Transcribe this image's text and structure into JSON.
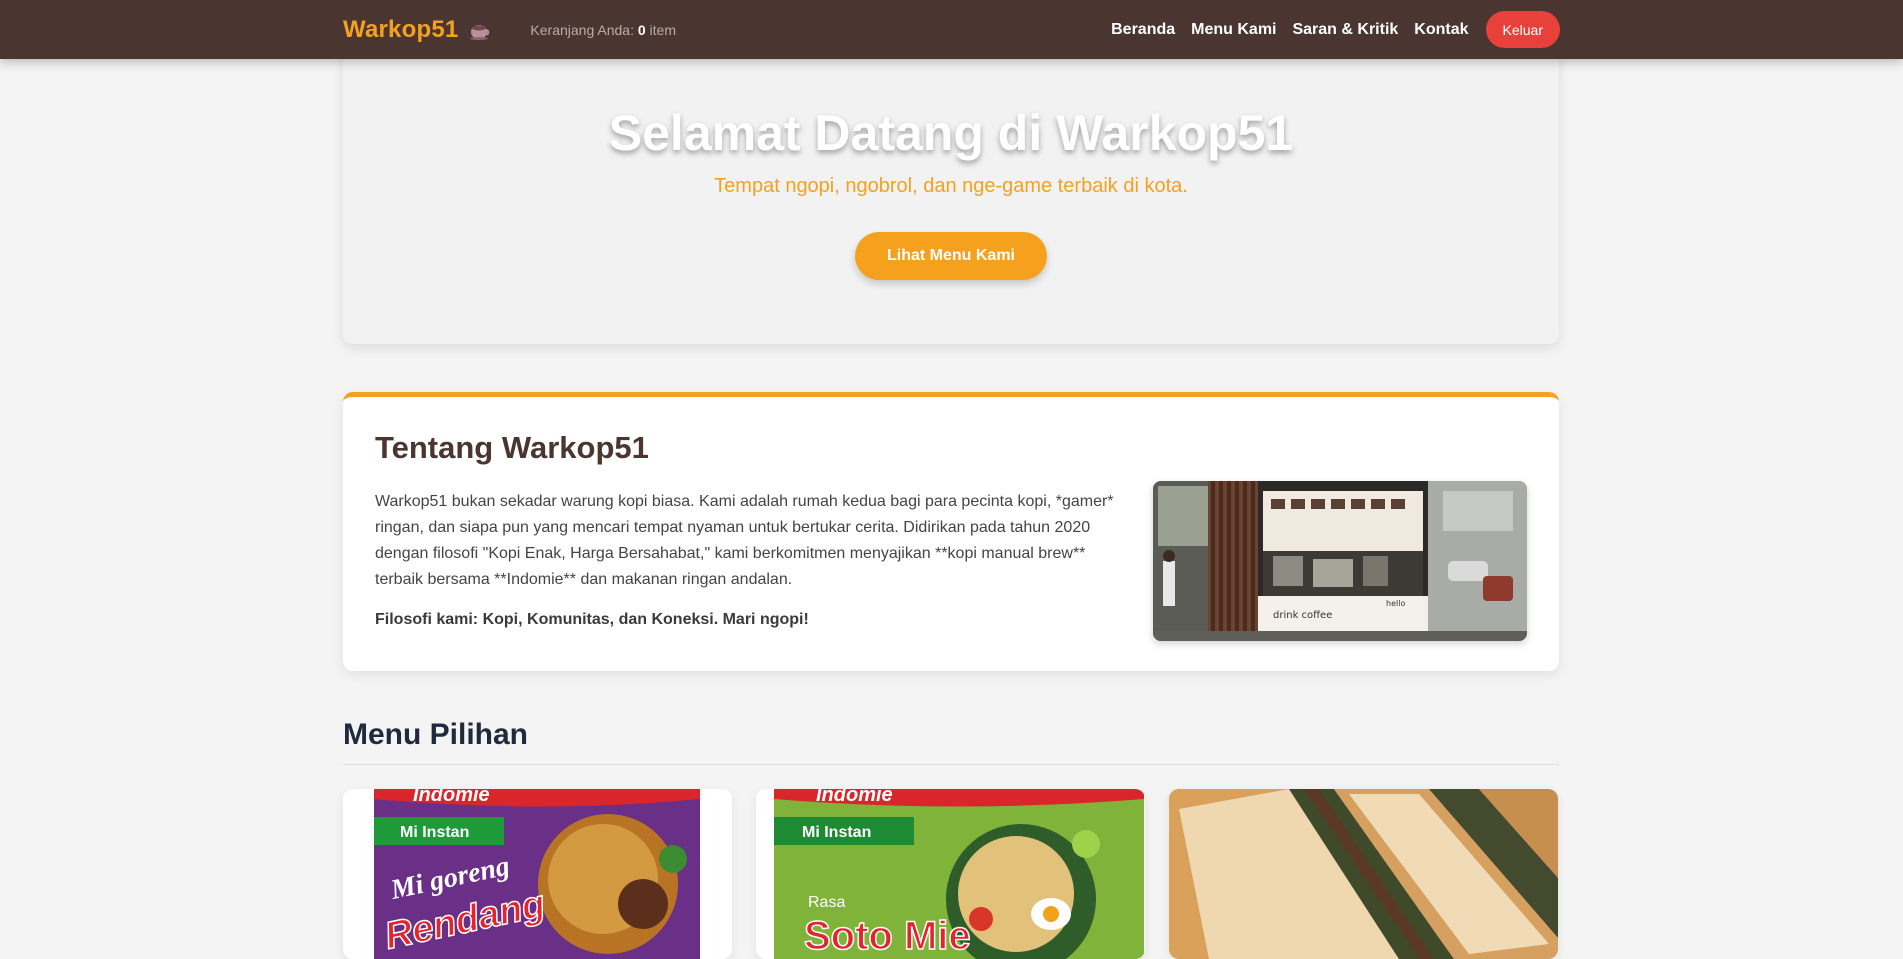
{
  "navbar": {
    "brand": "Warkop51",
    "brand_icon": "coffee-cup-icon",
    "cart_label": "Keranjang Anda:",
    "cart_count": "0",
    "cart_unit": "item",
    "links": [
      "Beranda",
      "Menu Kami",
      "Saran & Kritik",
      "Kontak"
    ],
    "logout_label": "Keluar"
  },
  "hero": {
    "title": "Selamat Datang di Warkop51",
    "subtitle": "Tempat ngopi, ngobrol, dan nge-game terbaik di kota.",
    "cta_label": "Lihat Menu Kami"
  },
  "about": {
    "title": "Tentang Warkop51",
    "body": "Warkop51 bukan sekadar warung kopi biasa. Kami adalah rumah kedua bagi para pecinta kopi, *gamer* ringan, dan siapa pun yang mencari tempat nyaman untuk bertukar cerita. Didirikan pada tahun 2020 dengan filosofi \"Kopi Enak, Harga Bersahabat,\" kami berkomitmen menyajikan **kopi manual brew** terbaik bersama **Indomie** dan makanan ringan andalan.",
    "philosophy": "Filosofi kami: Kopi, Komunitas, dan Koneksi. Mari ngopi!",
    "image_sign_1": "drink coffee",
    "image_sign_2": "hello"
  },
  "menu": {
    "heading": "Menu Pilihan",
    "cards": [
      {
        "pack_brand": "Indomie",
        "pack_type": "Mi Instan",
        "pack_line1": "Mi goreng",
        "pack_line2": "Rendang"
      },
      {
        "pack_brand": "Indomie",
        "pack_type": "Mi Instan",
        "pack_line1": "Rasa",
        "pack_line2": "Soto Mie"
      },
      {
        "image": "toasted-sandwich"
      }
    ]
  },
  "colors": {
    "navbar": "#4a3530",
    "accent": "#f5a11e",
    "logout": "#e8403a",
    "background": "#f4f4f4"
  }
}
